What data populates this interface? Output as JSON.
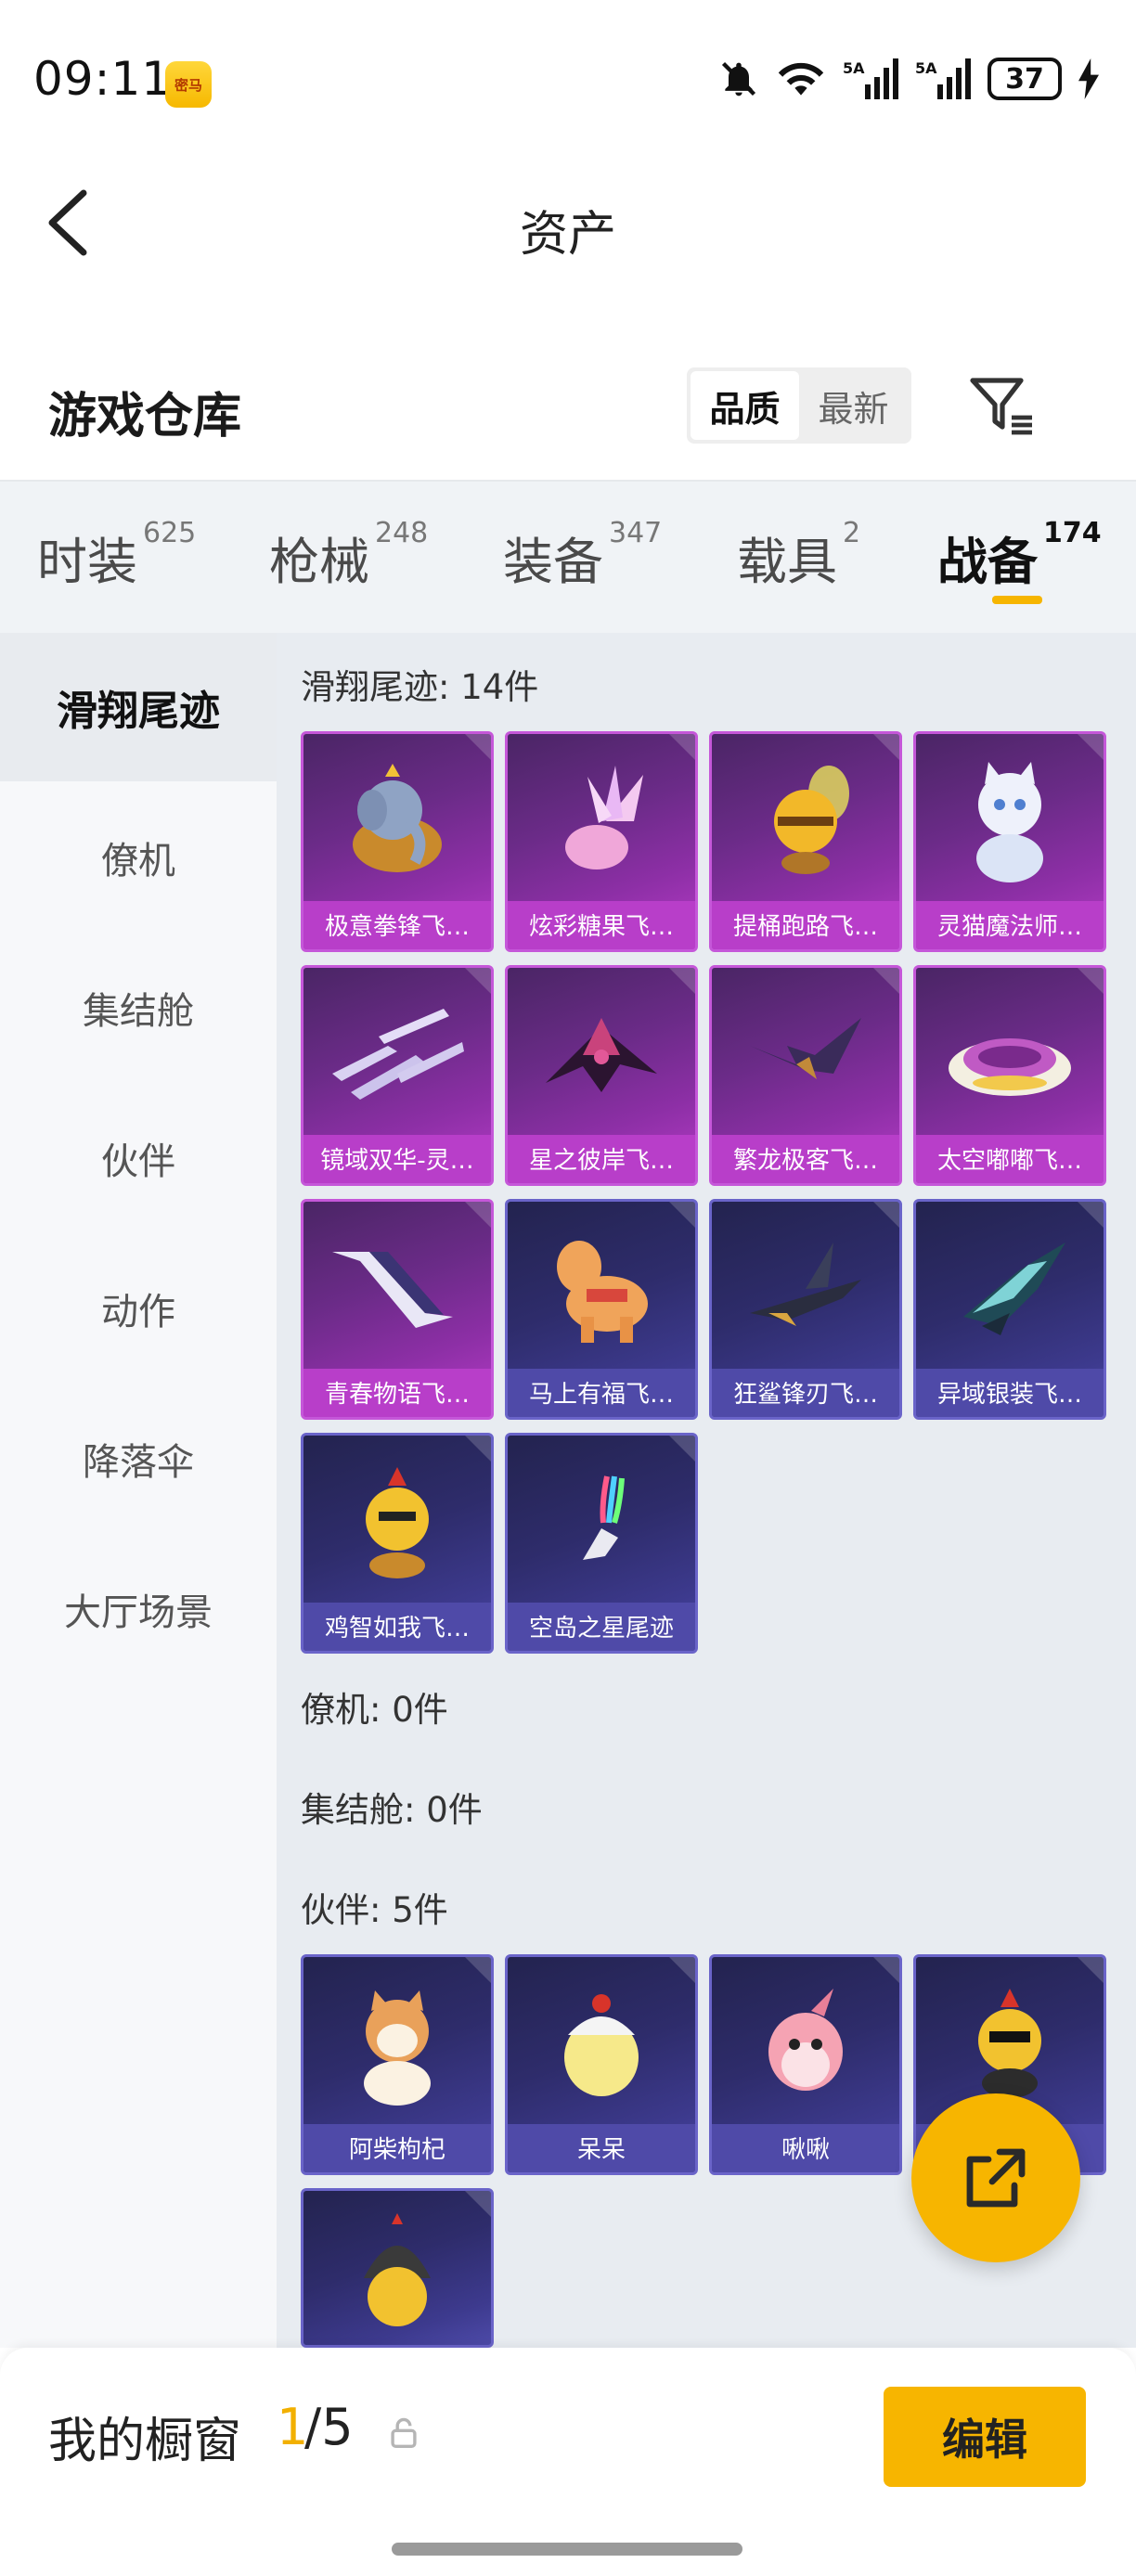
{
  "status": {
    "time": "09:11",
    "app_badge": "密马",
    "battery": "37"
  },
  "nav": {
    "title": "资产"
  },
  "warehouse": {
    "title": "游戏仓库",
    "sort_quality": "品质",
    "sort_newest": "最新"
  },
  "tabs": [
    {
      "label": "时装",
      "count": "625"
    },
    {
      "label": "枪械",
      "count": "248"
    },
    {
      "label": "装备",
      "count": "347"
    },
    {
      "label": "载具",
      "count": "2"
    },
    {
      "label": "战备",
      "count": "174",
      "active": true
    }
  ],
  "sidebar": {
    "items": [
      "滑翔尾迹",
      "僚机",
      "集结舱",
      "伙伴",
      "动作",
      "降落伞",
      "大厅场景"
    ],
    "active_index": 0
  },
  "sections": {
    "trails_label": "滑翔尾迹: 14件",
    "wingman_label": "僚机: 0件",
    "capsule_label": "集结舱: 0件",
    "partner_label": "伙伴: 5件"
  },
  "trail_items": [
    {
      "name": "极意拳锋飞…",
      "rarity": "purple"
    },
    {
      "name": "炫彩糖果飞…",
      "rarity": "purple"
    },
    {
      "name": "提桶跑路飞…",
      "rarity": "purple"
    },
    {
      "name": "灵猫魔法师…",
      "rarity": "purple"
    },
    {
      "name": "镜域双华-灵…",
      "rarity": "purple"
    },
    {
      "name": "星之彼岸飞…",
      "rarity": "purple"
    },
    {
      "name": "繁龙极客飞…",
      "rarity": "purple"
    },
    {
      "name": "太空嘟嘟飞…",
      "rarity": "purple"
    },
    {
      "name": "青春物语飞…",
      "rarity": "purple"
    },
    {
      "name": "马上有福飞…",
      "rarity": "blue"
    },
    {
      "name": "狂鲨锋刃飞…",
      "rarity": "blue"
    },
    {
      "name": "异域银装飞…",
      "rarity": "blue"
    },
    {
      "name": "鸡智如我飞…",
      "rarity": "blue"
    },
    {
      "name": "空岛之星尾迹",
      "rarity": "blue"
    }
  ],
  "partner_items": [
    {
      "name": "阿柴枸杞",
      "rarity": "blue"
    },
    {
      "name": "呆呆",
      "rarity": "blue"
    },
    {
      "name": "啾啾",
      "rarity": "blue"
    },
    {
      "name": "",
      "rarity": "blue"
    },
    {
      "name": "",
      "rarity": "blue"
    }
  ],
  "showcase": {
    "title": "我的橱窗",
    "current": "1",
    "total": "/5",
    "edit_label": "编辑"
  },
  "colors": {
    "accent": "#f7b500",
    "purple_card": "#8d2fa6",
    "blue_card": "#3d3a8e"
  }
}
